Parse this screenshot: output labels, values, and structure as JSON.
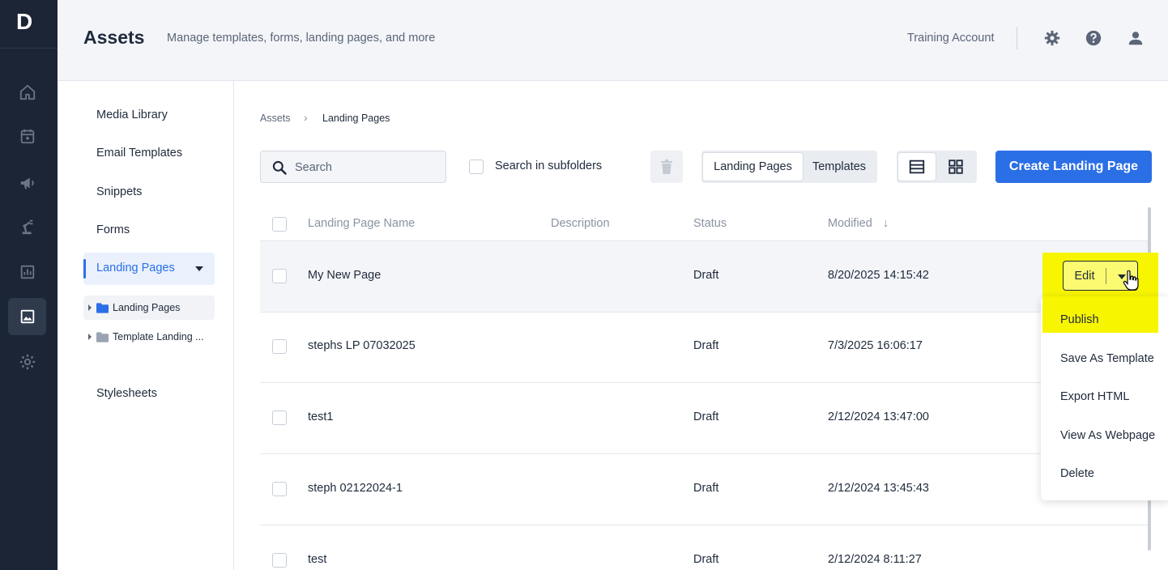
{
  "rail": {
    "logo": "D",
    "items": [
      "home",
      "calendar",
      "campaigns",
      "robot",
      "reports",
      "assets",
      "settings"
    ],
    "active": "assets"
  },
  "header": {
    "title": "Assets",
    "subtitle": "Manage templates, forms, landing pages, and more",
    "account": "Training Account"
  },
  "subnav": {
    "items": [
      "Media Library",
      "Email Templates",
      "Snippets",
      "Forms"
    ],
    "active": "Landing Pages",
    "folders": [
      "Landing Pages",
      "Template Landing ..."
    ],
    "stylesheets": "Stylesheets"
  },
  "breadcrumb": {
    "root": "Assets",
    "separator": "›",
    "current": "Landing Pages"
  },
  "toolbar": {
    "search_placeholder": "Search",
    "subfolders_label": "Search in subfolders",
    "toggle_options": [
      "Landing Pages",
      "Templates"
    ],
    "toggle_selected": "Landing Pages",
    "view_selected": "list",
    "create_label": "Create Landing Page"
  },
  "table": {
    "columns": {
      "name": "Landing Page Name",
      "description": "Description",
      "status": "Status",
      "modified": "Modified",
      "sort_arrow": "↓"
    },
    "rows": [
      {
        "name": "My New Page",
        "description": "",
        "status": "Draft",
        "modified": "8/20/2025 14:15:42"
      },
      {
        "name": "stephs LP 07032025",
        "description": "",
        "status": "Draft",
        "modified": "7/3/2025 16:06:17"
      },
      {
        "name": "test1",
        "description": "",
        "status": "Draft",
        "modified": "2/12/2024 13:47:00"
      },
      {
        "name": "steph 02122024-1",
        "description": "",
        "status": "Draft",
        "modified": "2/12/2024 13:45:43"
      },
      {
        "name": "test",
        "description": "",
        "status": "Draft",
        "modified": "2/12/2024 8:11:27"
      }
    ]
  },
  "row_actions": {
    "edit_label": "Edit",
    "menu": [
      "Publish",
      "Save As Template",
      "Export HTML",
      "View As Webpage",
      "Delete"
    ],
    "highlighted": "Publish"
  },
  "colors": {
    "accent": "#2b6fe6",
    "rail_bg": "#1c2536",
    "highlight": "#f7f500"
  }
}
